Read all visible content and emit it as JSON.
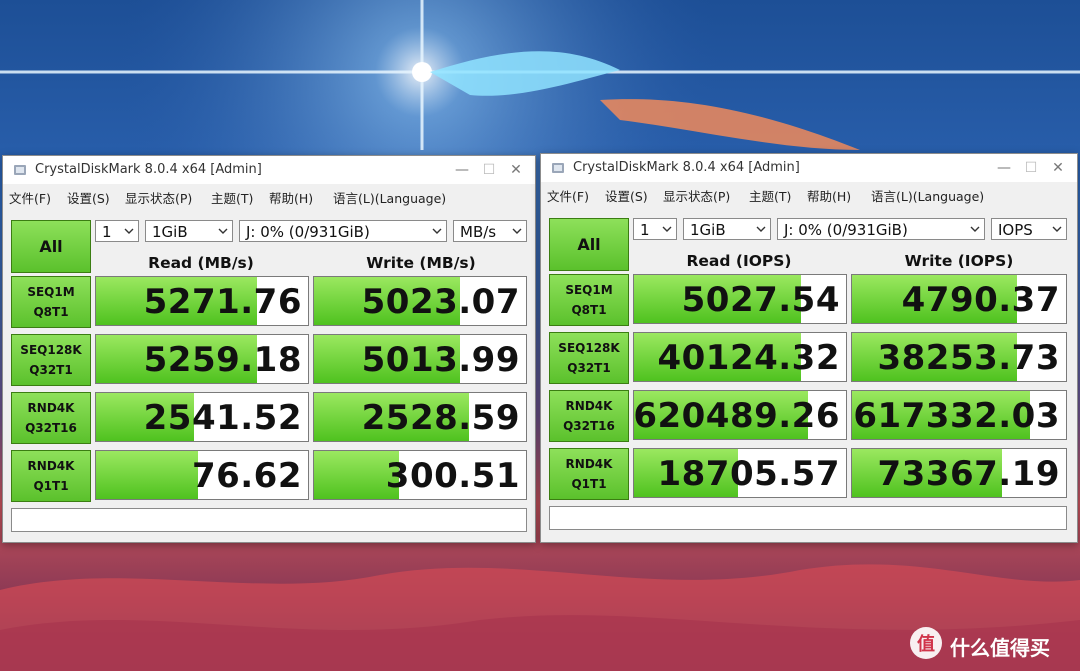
{
  "windows": [
    {
      "title": "CrystalDiskMark 8.0.4 x64 [Admin]",
      "menu": [
        "文件(F)",
        "设置(S)",
        "显示状态(P)",
        "主题(T)",
        "帮助(H)",
        "语言(L)(Language)"
      ],
      "all_label": "All",
      "count": "1",
      "size": "1GiB",
      "drive": "J: 0% (0/931GiB)",
      "unit": "MB/s",
      "read_header": "Read (MB/s)",
      "write_header": "Write (MB/s)",
      "rows": [
        {
          "l1": "SEQ1M",
          "l2": "Q8T1",
          "read": "5271.76",
          "write": "5023.07",
          "read_fill": 0.76,
          "write_fill": 0.69
        },
        {
          "l1": "SEQ128K",
          "l2": "Q32T1",
          "read": "5259.18",
          "write": "5013.99",
          "read_fill": 0.76,
          "write_fill": 0.69
        },
        {
          "l1": "RND4K",
          "l2": "Q32T16",
          "read": "2541.52",
          "write": "2528.59",
          "read_fill": 0.46,
          "write_fill": 0.73
        },
        {
          "l1": "RND4K",
          "l2": "Q1T1",
          "read": "76.62",
          "write": "300.51",
          "read_fill": 0.48,
          "write_fill": 0.4
        }
      ]
    },
    {
      "title": "CrystalDiskMark 8.0.4 x64 [Admin]",
      "menu": [
        "文件(F)",
        "设置(S)",
        "显示状态(P)",
        "主题(T)",
        "帮助(H)",
        "语言(L)(Language)"
      ],
      "all_label": "All",
      "count": "1",
      "size": "1GiB",
      "drive": "J: 0% (0/931GiB)",
      "unit": "IOPS",
      "read_header": "Read (IOPS)",
      "write_header": "Write (IOPS)",
      "rows": [
        {
          "l1": "SEQ1M",
          "l2": "Q8T1",
          "read": "5027.54",
          "write": "4790.37",
          "read_fill": 0.79,
          "write_fill": 0.77
        },
        {
          "l1": "SEQ128K",
          "l2": "Q32T1",
          "read": "40124.32",
          "write": "38253.73",
          "read_fill": 0.79,
          "write_fill": 0.77
        },
        {
          "l1": "RND4K",
          "l2": "Q32T16",
          "read": "620489.26",
          "write": "617332.03",
          "read_fill": 0.82,
          "write_fill": 0.83
        },
        {
          "l1": "RND4K",
          "l2": "Q1T1",
          "read": "18705.57",
          "write": "73367.19",
          "read_fill": 0.49,
          "write_fill": 0.7
        }
      ]
    }
  ],
  "watermark": {
    "text": "什么值得买",
    "icon": "zhi-logo-icon"
  },
  "colors": {
    "bar_green": "#5bc12c",
    "button_green": "#8ee05a",
    "window_bg": "#f0f0f0"
  }
}
